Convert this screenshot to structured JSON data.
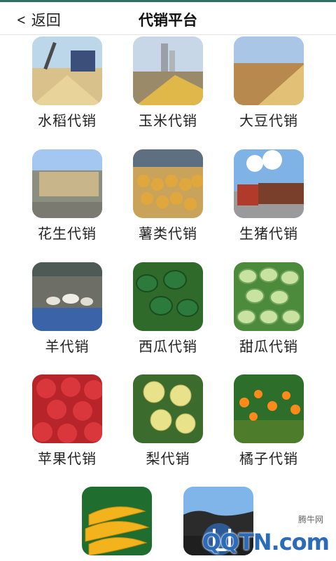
{
  "header": {
    "back_label": "返回",
    "title": "代销平台"
  },
  "items": [
    {
      "label": "水稻代销"
    },
    {
      "label": "玉米代销"
    },
    {
      "label": "大豆代销"
    },
    {
      "label": "花生代销"
    },
    {
      "label": "薯类代销"
    },
    {
      "label": "生猪代销"
    },
    {
      "label": "羊代销"
    },
    {
      "label": "西瓜代销"
    },
    {
      "label": "甜瓜代销"
    },
    {
      "label": "苹果代销"
    },
    {
      "label": "梨代销"
    },
    {
      "label": "橘子代销"
    },
    {
      "label": ""
    },
    {
      "label": ""
    }
  ],
  "watermark": {
    "site_cn": "腾牛网",
    "site_en": "QQTN.com"
  }
}
